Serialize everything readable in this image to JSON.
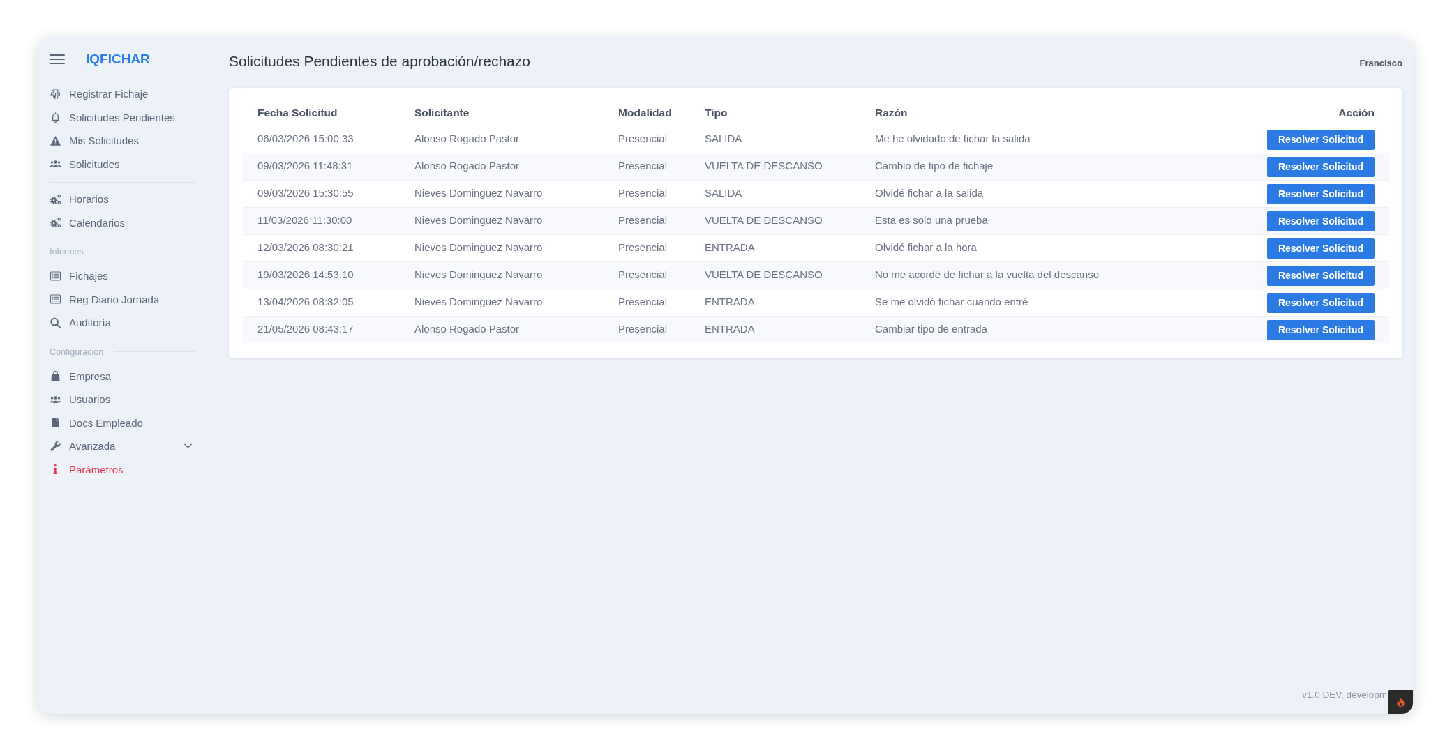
{
  "sidebar": {
    "logo": "IQFICHAR",
    "sections": [
      {
        "items": [
          {
            "label": "Registrar Fichaje",
            "alert": false
          },
          {
            "label": "Solicitudes Pendientes",
            "alert": false
          },
          {
            "label": "Mis Solicitudes",
            "alert": false
          },
          {
            "label": "Solicitudes",
            "alert": false
          }
        ]
      },
      {
        "items": [
          {
            "label": "Horarios",
            "alert": false
          },
          {
            "label": "Calendarios",
            "alert": false
          }
        ]
      },
      {
        "label": "Informes",
        "items": [
          {
            "label": "Fichajes",
            "alert": false
          },
          {
            "label": "Reg Diario Jornada",
            "alert": false
          },
          {
            "label": "Auditoría",
            "alert": false
          }
        ]
      },
      {
        "label": "Configuración",
        "items": [
          {
            "label": "Empresa",
            "alert": false
          },
          {
            "label": "Usuarios",
            "alert": false
          },
          {
            "label": "Docs Empleado",
            "alert": false
          },
          {
            "label": "Avanzada",
            "alert": false,
            "expanded": false
          },
          {
            "label": "Parámetros",
            "alert": true
          }
        ]
      }
    ]
  },
  "header": {
    "title": "Solicitudes Pendientes de aprobación/rechazo",
    "user": "Francisco"
  },
  "table": {
    "columns": [
      "Fecha Solicitud",
      "Solicitante",
      "Modalidad",
      "Tipo",
      "Razón",
      "Acción"
    ],
    "rows": [
      {
        "cells": [
          "06/03/2026 15:00:33",
          "Alonso Rogado Pastor",
          "Presencial",
          "SALIDA",
          "Me he olvidado de fichar la salida"
        ],
        "action": "Resolver Solicitud"
      },
      {
        "cells": [
          "09/03/2026 11:48:31",
          "Alonso Rogado Pastor",
          "Presencial",
          "VUELTA DE DESCANSO",
          "Cambio de tipo de fichaje"
        ],
        "action": "Resolver Solicitud"
      },
      {
        "cells": [
          "09/03/2026 15:30:55",
          "Nieves Dominguez Navarro",
          "Presencial",
          "SALIDA",
          "Olvidé fichar a la salida"
        ],
        "action": "Resolver Solicitud"
      },
      {
        "cells": [
          "11/03/2026 11:30:00",
          "Nieves Dominguez Navarro",
          "Presencial",
          "VUELTA DE DESCANSO",
          "Esta es solo una prueba"
        ],
        "action": "Resolver Solicitud"
      },
      {
        "cells": [
          "12/03/2026 08:30:21",
          "Nieves Dominguez Navarro",
          "Presencial",
          "ENTRADA",
          "Olvidé fichar a la hora"
        ],
        "action": "Resolver Solicitud"
      },
      {
        "cells": [
          "19/03/2026 14:53:10",
          "Nieves Dominguez Navarro",
          "Presencial",
          "VUELTA DE DESCANSO",
          "No me acordé de fichar a la vuelta del descanso"
        ],
        "action": "Resolver Solicitud"
      },
      {
        "cells": [
          "13/04/2026 08:32:05",
          "Nieves Dominguez Navarro",
          "Presencial",
          "ENTRADA",
          "Se me olvidó fichar cuando entré"
        ],
        "action": "Resolver Solicitud"
      },
      {
        "cells": [
          "21/05/2026 08:43:17",
          "Alonso Rogado Pastor",
          "Presencial",
          "ENTRADA",
          "Cambiar tipo de entrada"
        ],
        "action": "Resolver Solicitud"
      }
    ]
  },
  "footer": {
    "version": "v1.0 DEV, developm"
  }
}
